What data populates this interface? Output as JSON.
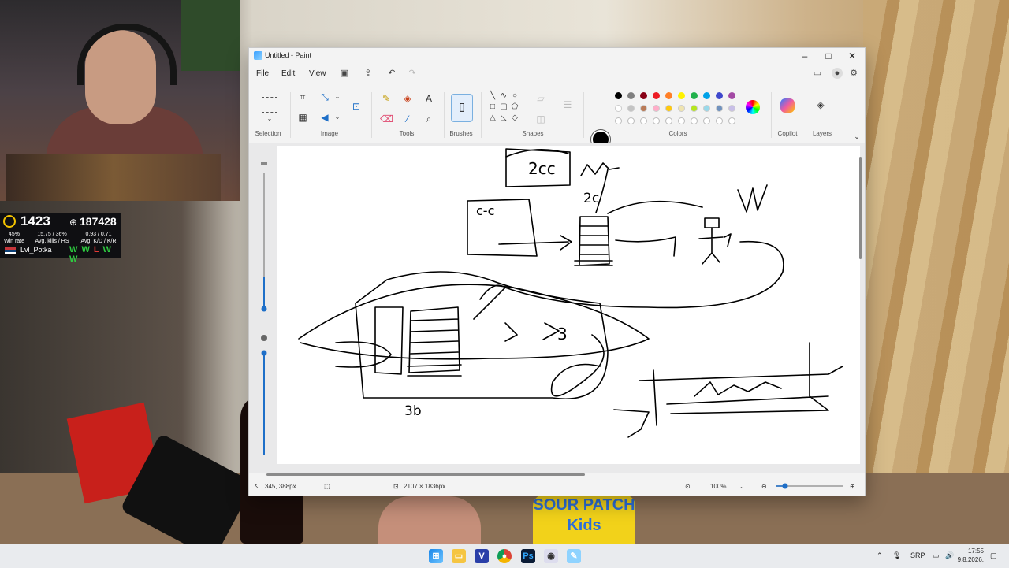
{
  "overlay": {
    "elo": "1423",
    "points": "187428",
    "stats": [
      {
        "value": "45%",
        "label": "Win rate"
      },
      {
        "value": "15.75 / 36%",
        "label": "Avg. kills / HS"
      },
      {
        "value": "0.93 / 0.71",
        "label": "Avg. K/D / K/R"
      }
    ],
    "username": "Lvl_Potka",
    "streak": [
      "W",
      "W",
      "L",
      "W",
      "W"
    ],
    "streak_colors": {
      "W": "#2ecc40",
      "L": "#e53935"
    }
  },
  "desk": {
    "candy_text": "SOUR PATCH Kids"
  },
  "paint": {
    "title": "Untitled - Paint",
    "menus": [
      "File",
      "Edit",
      "View"
    ],
    "groups": {
      "selection": "Selection",
      "image": "Image",
      "tools": "Tools",
      "brushes": "Brushes",
      "shapes": "Shapes",
      "colors": "Colors",
      "copilot": "Copilot",
      "layers": "Layers"
    },
    "palette_row1": [
      "#000000",
      "#7f7f7f",
      "#880015",
      "#ed1c24",
      "#ff7f27",
      "#fff200",
      "#22b14c",
      "#00a2e8",
      "#3f48cc",
      "#a349a4"
    ],
    "palette_row2": [
      "#ffffff",
      "#c3c3c3",
      "#b97a57",
      "#ffaec9",
      "#ffc90e",
      "#efe4b0",
      "#b5e61d",
      "#99d9ea",
      "#7092be",
      "#c8bfe7"
    ],
    "status": {
      "cursor_pos": "345, 388px",
      "canvas_size": "2107 × 1836px",
      "zoom": "100%"
    },
    "drawing_text": [
      "2cc",
      "c-c",
      "2c",
      "3b",
      "3",
      "3"
    ]
  },
  "taskbar": {
    "tray_lang": "SRP",
    "time": "17:55",
    "date": "9.8.2026."
  }
}
